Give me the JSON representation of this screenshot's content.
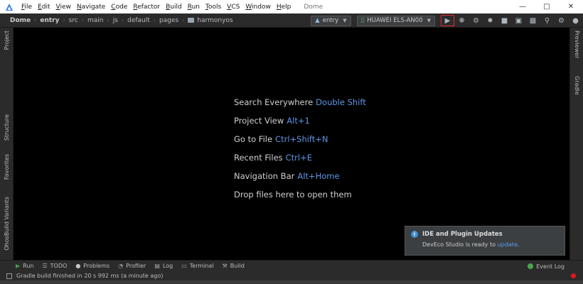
{
  "titlebar": {
    "menu": [
      "File",
      "Edit",
      "View",
      "Navigate",
      "Code",
      "Refactor",
      "Build",
      "Run",
      "Tools",
      "VCS",
      "Window",
      "Help"
    ],
    "project_title": "Dome",
    "window_controls": [
      "minimize",
      "maximize",
      "close"
    ]
  },
  "navbar": {
    "crumbs": [
      {
        "label": "Dome",
        "bold": true
      },
      {
        "label": "entry",
        "bold": true
      },
      {
        "label": "src",
        "bold": false
      },
      {
        "label": "main",
        "bold": false
      },
      {
        "label": "js",
        "bold": false
      },
      {
        "label": "default",
        "bold": false
      },
      {
        "label": "pages",
        "bold": false
      },
      {
        "label": "harmonyos",
        "bold": false,
        "folder": true
      }
    ],
    "module_select": "entry",
    "device_select": "HUAWEI ELS-AN00",
    "toolbar_icons": [
      "run-icon",
      "debug-icon",
      "attach-debugger-icon",
      "profiler-icon",
      "stop-icon",
      "project-structure-icon",
      "device-manager-icon",
      "search-icon",
      "settings-icon",
      "account-icon"
    ]
  },
  "left_strip": {
    "tabs": [
      "Project",
      "Structure",
      "Favorites",
      "OhosBuild Variants"
    ]
  },
  "right_strip": {
    "tabs": [
      "Previewer",
      "Gradle"
    ]
  },
  "editor": {
    "hints": [
      {
        "label": "Search Everywhere",
        "key": "Double Shift"
      },
      {
        "label": "Project View",
        "key": "Alt+1"
      },
      {
        "label": "Go to File",
        "key": "Ctrl+Shift+N"
      },
      {
        "label": "Recent Files",
        "key": "Ctrl+E"
      },
      {
        "label": "Navigation Bar",
        "key": "Alt+Home"
      },
      {
        "label": "Drop files here to open them",
        "key": ""
      }
    ]
  },
  "notification": {
    "title": "IDE and Plugin Updates",
    "body": "DevEco Studio is ready to",
    "link": "update",
    "suffix": "."
  },
  "bottom_tabs": [
    {
      "label": "Run",
      "icon": "run-icon",
      "glyph": "▶"
    },
    {
      "label": "TODO",
      "icon": "todo-icon",
      "glyph": "☰"
    },
    {
      "label": "Problems",
      "icon": "problems-icon",
      "glyph": "●"
    },
    {
      "label": "Profiler",
      "icon": "profiler-icon",
      "glyph": "◔"
    },
    {
      "label": "Log",
      "icon": "log-icon",
      "glyph": "▤"
    },
    {
      "label": "Terminal",
      "icon": "terminal-icon",
      "glyph": "▭"
    },
    {
      "label": "Build",
      "icon": "build-icon",
      "glyph": "⚒"
    }
  ],
  "event_log": "Event Log",
  "status": {
    "message": "Gradle build finished in 20 s 992 ms (a minute ago)"
  },
  "colors": {
    "accent_blue": "#5e95e6",
    "run_highlight": "#e2262a",
    "editor_bg": "#000000",
    "panel_bg": "#2b2b2b"
  }
}
